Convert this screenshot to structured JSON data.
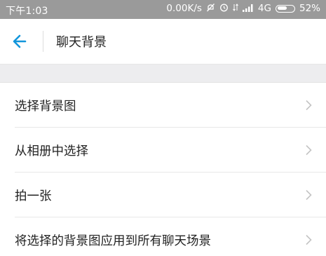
{
  "status_bar": {
    "time": "下午1:03",
    "speed": "0.00K/s",
    "network": "4G",
    "battery": "52%",
    "icons": [
      "mute-icon",
      "alarm-icon",
      "data-arrows-icon",
      "signal-icon",
      "battery-icon"
    ]
  },
  "header": {
    "back_icon": "back-arrow-icon",
    "title": "聊天背景"
  },
  "menu": {
    "items": [
      {
        "label": "选择背景图"
      },
      {
        "label": "从相册中选择"
      },
      {
        "label": "拍一张"
      },
      {
        "label": "将选择的背景图应用到所有聊天场景"
      }
    ]
  },
  "colors": {
    "status_bar_bg": "#9a9a9a",
    "accent": "#1296db",
    "section_gap": "#ededef",
    "chevron": "#c4c4c4"
  }
}
